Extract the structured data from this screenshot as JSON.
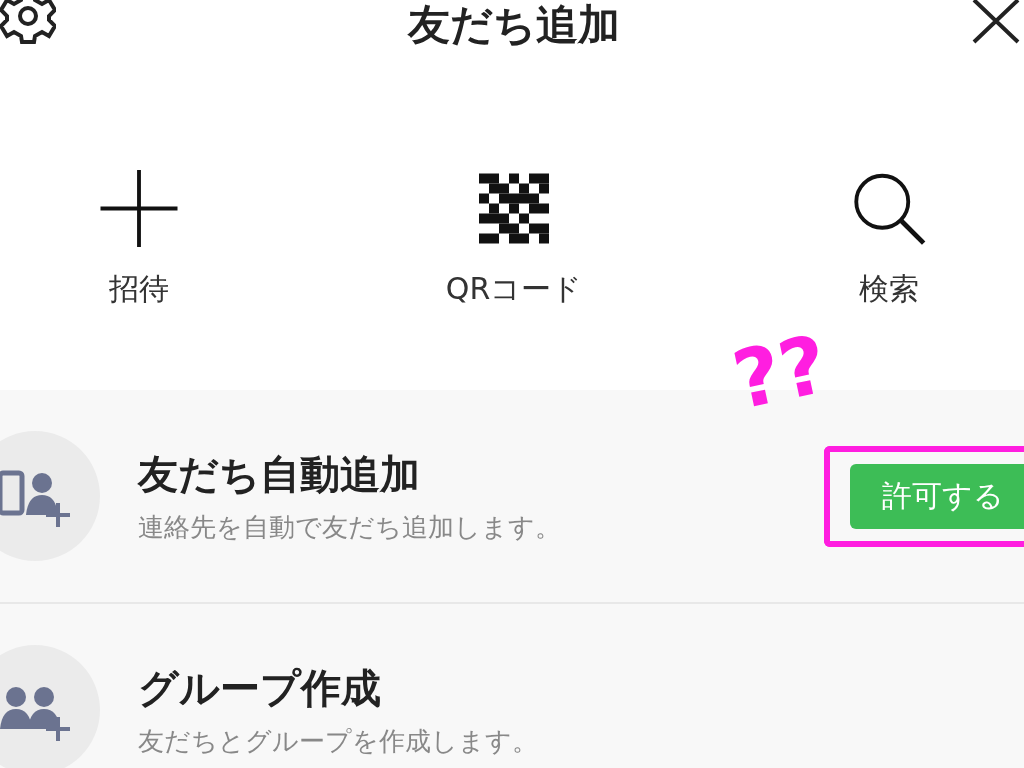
{
  "header": {
    "title": "友だち追加"
  },
  "actions": [
    {
      "kind": "plus",
      "label": "招待"
    },
    {
      "kind": "qr",
      "label": "QRコード"
    },
    {
      "kind": "search",
      "label": "検索"
    }
  ],
  "items": [
    {
      "kind": "auto",
      "title": "友だち自動追加",
      "subtitle": "連絡先を自動で友だち追加します。",
      "button": {
        "label": "許可する",
        "highlighted": true
      }
    },
    {
      "kind": "group",
      "title": "グループ作成",
      "subtitle": "友だちとグループを作成します。"
    }
  ],
  "annotation": {
    "text": "??"
  }
}
